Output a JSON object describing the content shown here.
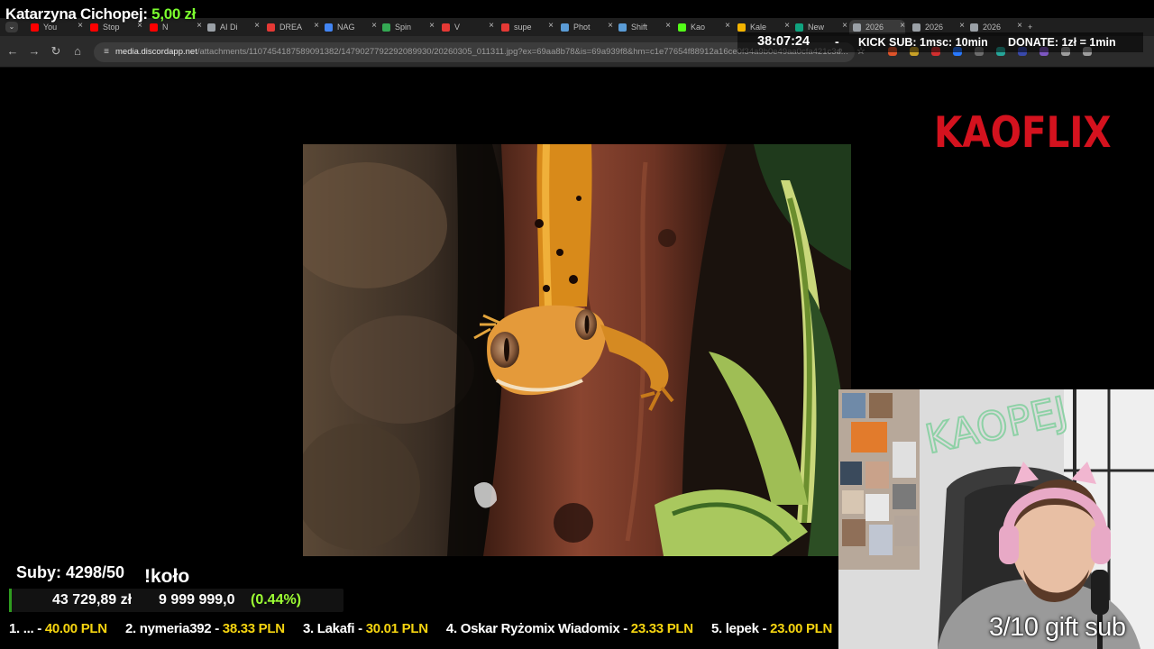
{
  "browser": {
    "tabs": [
      {
        "label": "You",
        "icon": "youtube-icon",
        "color": "#ff0000"
      },
      {
        "label": "Stop",
        "icon": "youtube-icon",
        "color": "#ff0000"
      },
      {
        "label": "N",
        "icon": "youtube-icon",
        "color": "#ff0000"
      },
      {
        "label": "AI Di",
        "icon": "globe-icon",
        "color": "#9aa0a6"
      },
      {
        "label": "DREA",
        "icon": "dream-icon",
        "color": "#e53935"
      },
      {
        "label": "NAG",
        "icon": "docs-icon",
        "color": "#4285f4"
      },
      {
        "label": "Spin",
        "icon": "spin-icon",
        "color": "#34a853"
      },
      {
        "label": "V",
        "icon": "record-icon",
        "color": "#e53935"
      },
      {
        "label": "supe",
        "icon": "red-circle-icon",
        "color": "#e53935"
      },
      {
        "label": "Phot",
        "icon": "steam-icon",
        "color": "#5a9bd5"
      },
      {
        "label": "Shift",
        "icon": "steam-icon",
        "color": "#5a9bd5"
      },
      {
        "label": "Kao",
        "icon": "kick-icon",
        "color": "#53fc18"
      },
      {
        "label": "Kale",
        "icon": "calendar-icon",
        "color": "#f4b400"
      },
      {
        "label": "New",
        "icon": "chatgpt-icon",
        "color": "#10a37f"
      },
      {
        "label": "2026",
        "icon": "globe-icon",
        "color": "#9aa0a6"
      },
      {
        "label": "2026",
        "icon": "globe-icon",
        "color": "#9aa0a6"
      },
      {
        "label": "2026",
        "icon": "globe-icon",
        "color": "#9aa0a6"
      }
    ],
    "new_tab": "+",
    "url_host": "media.discordapp.net",
    "url_path": "/attachments/1107454187589091382/1479027792292089930/20260305_011311.jpg?ex=69aa8b78&is=69a939f8&hm=c1e77654f88912a16ce0f34a9b0e49aa0cfa421c3d..."
  },
  "overlay": {
    "donor_name": "Katarzyna Cichopej:",
    "donor_amount": "5,00 zł",
    "timer": "38:07:24",
    "dash": "-",
    "kick_sub": "KICK SUB: 1msc: 10min",
    "donate": "DONATE: 1zł = 1min",
    "logo": "KAOFLIX",
    "gift_sub": "3/10 gift sub",
    "subs": "Suby: 4298/50",
    "kolo": "!koło",
    "goal_current": "43 729,89 zł",
    "goal_target": "9 999 999,0",
    "goal_percent": "(0.44%)",
    "goal_fraction": 0.0044
  },
  "leaderboard": [
    {
      "rank_name": "1. ... - ",
      "amount": "40.00 PLN"
    },
    {
      "rank_name": "2. nymeria392 - ",
      "amount": "38.33 PLN"
    },
    {
      "rank_name": "3. Lakafi - ",
      "amount": "30.01 PLN"
    },
    {
      "rank_name": "4. Oskar Ryżomix Wiadomix - ",
      "amount": "23.33 PLN"
    },
    {
      "rank_name": "5. lepek - ",
      "amount": "23.00 PLN"
    }
  ],
  "webcam_sign": "KAOPEJ",
  "colors": {
    "accent_green": "#7cff2f",
    "leader_amount": "#f5d410",
    "logo_red": "#d4121e"
  }
}
